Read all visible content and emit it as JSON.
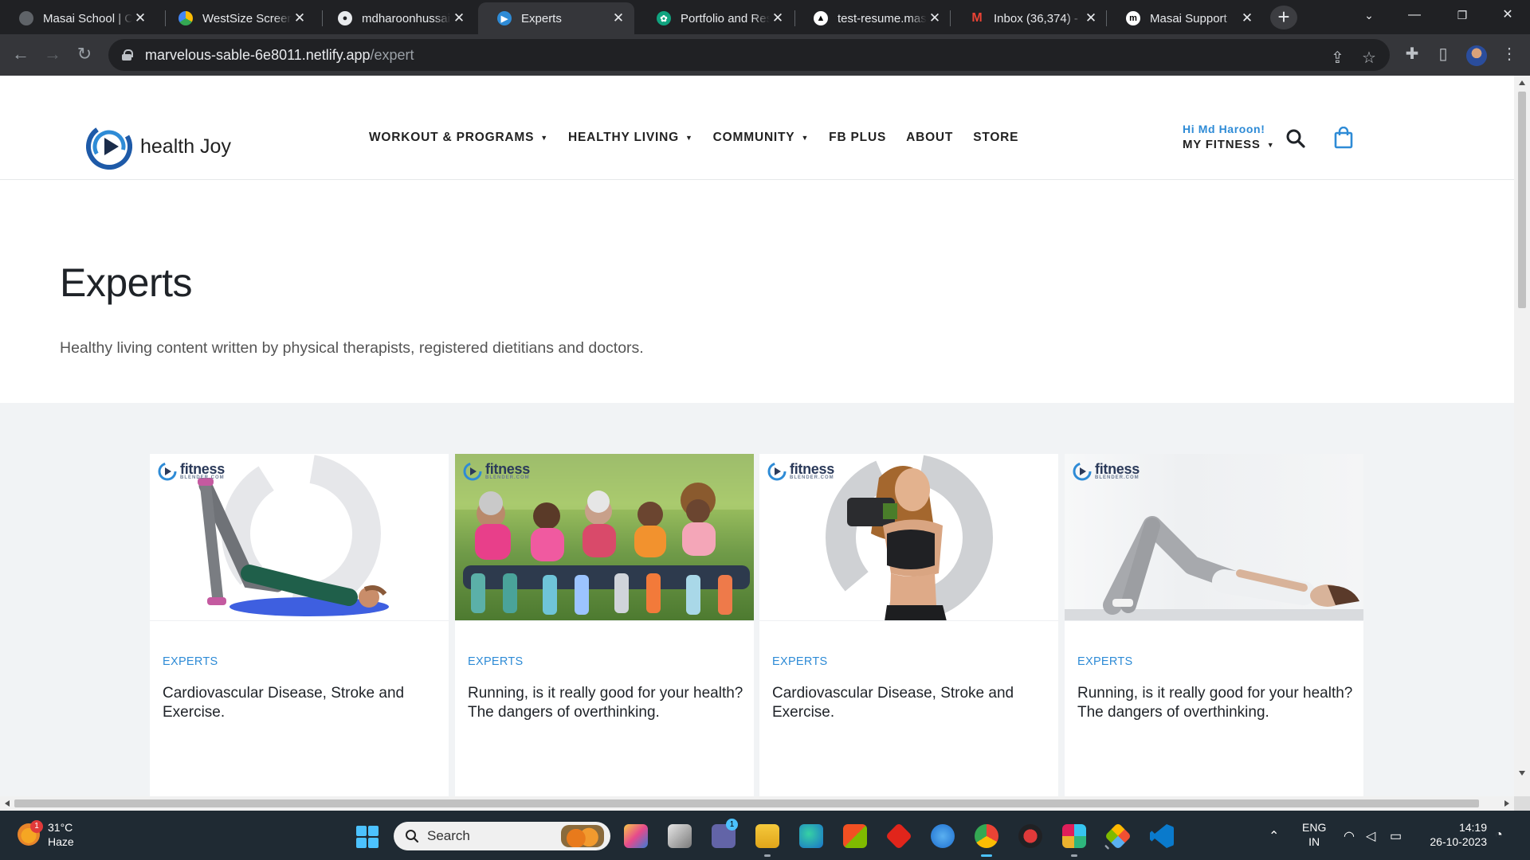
{
  "browser": {
    "tabs": [
      {
        "title": "Masai School | Co",
        "icon_color": "#5f6368",
        "icon": "masai-icon"
      },
      {
        "title": "WestSize Screens",
        "icon_color": "#34a853",
        "icon": "drive-icon"
      },
      {
        "title": "mdharoonhussai",
        "icon_color": "#e8eaed",
        "icon": "github-icon"
      },
      {
        "title": "Experts",
        "icon_color": "#2e8bd6",
        "icon": "healthjoy-icon",
        "active": true
      },
      {
        "title": "Portfolio and Res",
        "icon_color": "#10a37f",
        "icon": "openai-icon"
      },
      {
        "title": "test-resume.mas",
        "icon_color": "#ffffff",
        "icon": "netlify-icon"
      },
      {
        "title": "Inbox (36,374) - ",
        "icon_color": "#ea4335",
        "icon": "gmail-icon"
      },
      {
        "title": "Masai Support",
        "icon_color": "#ffffff",
        "icon": "masai-m-icon"
      }
    ],
    "url_host": "marvelous-sable-6e8011.netlify.app",
    "url_path": "/expert"
  },
  "site": {
    "logo_text": "health Joy",
    "nav": [
      {
        "label": "WORKOUT & PROGRAMS",
        "dropdown": true
      },
      {
        "label": "HEALTHY LIVING",
        "dropdown": true
      },
      {
        "label": "COMMUNITY",
        "dropdown": true
      },
      {
        "label": "FB PLUS",
        "dropdown": false
      },
      {
        "label": "ABOUT",
        "dropdown": false
      },
      {
        "label": "STORE",
        "dropdown": false
      }
    ],
    "greeting": "Hi Md Haroon!",
    "account_menu": "MY FITNESS",
    "accent_color": "#2e8bd6"
  },
  "hero": {
    "title": "Experts",
    "subtitle": "Healthy living content written by physical therapists, registered dietitians and doctors."
  },
  "cards": [
    {
      "tag": "EXPERTS",
      "title": "Cardiovascular Disease, Stroke and Exercise.",
      "image": "woman-glute-bridge-on-mat",
      "brand": "fitness",
      "brand_sub": "BLENDER.COM"
    },
    {
      "tag": "EXPERTS",
      "title": "Running, is it really good for your health? The dangers of overthinking.",
      "image": "group-stretching-in-park",
      "brand": "fitness",
      "brand_sub": "BLENDER.COM"
    },
    {
      "tag": "EXPERTS",
      "title": "Cardiovascular Disease, Stroke and Exercise.",
      "image": "woman-with-dumbbell",
      "brand": "fitness",
      "brand_sub": "BLENDER.COM"
    },
    {
      "tag": "EXPERTS",
      "title": "Running, is it really good for your health? The dangers of overthinking.",
      "image": "woman-lying-on-floor",
      "brand": "fitness",
      "brand_sub": "BLENDER.COM"
    }
  ],
  "taskbar": {
    "weather_temp": "31°C",
    "weather_desc": "Haze",
    "weather_badge": "1",
    "search_placeholder": "Search",
    "language": "ENG",
    "region": "IN",
    "time": "14:19",
    "date": "26-10-2023",
    "teams_badge": "1"
  }
}
